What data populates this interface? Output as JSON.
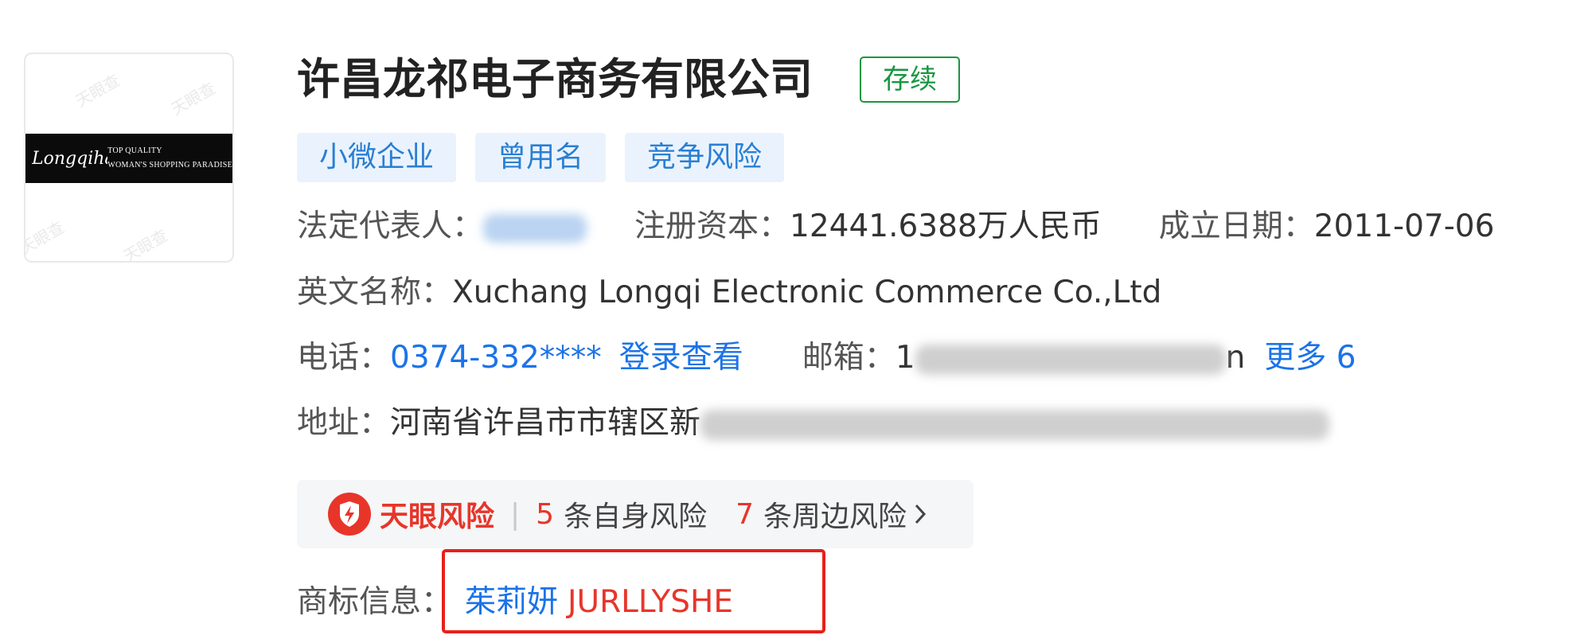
{
  "company": {
    "name": "许昌龙祁电子商务有限公司",
    "status": "存续",
    "logo": {
      "script_text": "Longqihair",
      "tagline_1": "TOP QUALITY",
      "tagline_2": "WOMAN'S SHOPPING PARADISE",
      "watermark": "天眼查"
    }
  },
  "tags": [
    "小微企业",
    "曾用名",
    "竞争风险"
  ],
  "info": {
    "legal_rep_label": "法定代表人：",
    "capital_label": "注册资本：",
    "capital_value": "12441.6388万人民币",
    "founded_label": "成立日期：",
    "founded_value": "2011-07-06",
    "english_label": "英文名称：",
    "english_value": "Xuchang Longqi Electronic Commerce Co.,Ltd",
    "phone_label": "电话：",
    "phone_value": "0374-332****",
    "phone_login_link": "登录查看",
    "email_label": "邮箱：",
    "email_prefix": "1",
    "email_suffix": "n",
    "more_link": "更多 6",
    "address_label": "地址：",
    "address_value": "河南省许昌市市辖区新"
  },
  "risk": {
    "brand": "天眼风险",
    "self_count": "5",
    "self_label": "条自身风险",
    "around_count": "7",
    "around_label": "条周边风险",
    "colors": {
      "accent": "#e8352a",
      "background": "#f5f6f7"
    },
    "icon": "shield-lightning-icon"
  },
  "trademark": {
    "label": "商标信息：",
    "name_cn": "茱莉妍",
    "name_en": "JURLLYSHE"
  },
  "colors": {
    "link_blue": "#1b73e8",
    "status_green": "#1a9641",
    "tag_bg": "#eaf3fd",
    "highlight_red": "#e8201a"
  }
}
